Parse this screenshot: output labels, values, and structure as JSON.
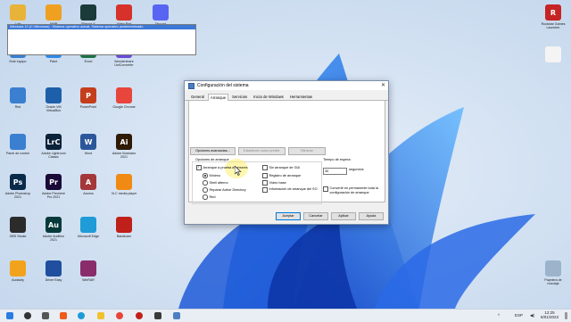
{
  "desktop": {
    "icons_col1": [
      {
        "label": "Lola",
        "icon": "folder-icon",
        "color": "#e8b339"
      },
      {
        "label": "Este equipo",
        "icon": "computer-icon",
        "color": "#3a7fd0"
      },
      {
        "label": "Red",
        "icon": "network-icon",
        "color": "#3a7fd0"
      },
      {
        "label": "Panel de control",
        "icon": "control-panel-icon",
        "color": "#3a7fd0"
      },
      {
        "label": "Adobe Photoshop 2021",
        "icon": "photoshop-icon",
        "color": "#0a2a4a",
        "glyph": "Ps"
      },
      {
        "label": "OBS Studio",
        "icon": "obs-icon",
        "color": "#2b2b2b"
      },
      {
        "label": "Audacity",
        "icon": "audacity-icon",
        "color": "#f2a31b"
      }
    ],
    "icons_col2": [
      {
        "label": "AIMP",
        "icon": "aimp-icon",
        "color": "#f0a020"
      },
      {
        "label": "Paint",
        "icon": "paint-icon",
        "color": "#2e8ae6"
      },
      {
        "label": "Oracle VM VirtualBox",
        "icon": "virtualbox-icon",
        "color": "#1d5fa8"
      },
      {
        "label": "Adobe Lightroom Classic",
        "icon": "lightroom-icon",
        "color": "#0b2239",
        "glyph": "LrC"
      },
      {
        "label": "Adobe Premiere Pro 2021",
        "icon": "premiere-icon",
        "color": "#1a0a38",
        "glyph": "Pr"
      },
      {
        "label": "Adobe Audition 2021",
        "icon": "audition-icon",
        "color": "#063a3a",
        "glyph": "Au"
      },
      {
        "label": "Driver Easy",
        "icon": "drivereasy-icon",
        "color": "#1f4f9e"
      }
    ],
    "icons_col3": [
      {
        "label": "Filmora X",
        "icon": "filmora-icon",
        "color": "#1b3a3a"
      },
      {
        "label": "Excel",
        "icon": "excel-icon",
        "color": "#1e7145",
        "glyph": "X"
      },
      {
        "label": "PowerPoint",
        "icon": "powerpoint-icon",
        "color": "#c43e1c",
        "glyph": "P"
      },
      {
        "label": "Word",
        "icon": "word-icon",
        "color": "#2b579a",
        "glyph": "W"
      },
      {
        "label": "Access",
        "icon": "access-icon",
        "color": "#a4373a",
        "glyph": "A"
      },
      {
        "label": "Microsoft Edge",
        "icon": "edge-icon",
        "color": "#1f9bd7"
      },
      {
        "label": "WinRAR",
        "icon": "winrar-icon",
        "color": "#8a2b6a"
      }
    ],
    "icons_col4": [
      {
        "label": "Video Pad",
        "icon": "videopad-icon",
        "color": "#d6312b"
      },
      {
        "label": "Wondershare UniConverter",
        "icon": "uniconverter-icon",
        "color": "#6a4bd6"
      },
      {
        "label": "Google Chrome",
        "icon": "chrome-icon",
        "color": "#e8453c"
      },
      {
        "label": "Adobe Illustrator 2021",
        "icon": "illustrator-icon",
        "color": "#2e1a05",
        "glyph": "Ai"
      },
      {
        "label": "VLC media player",
        "icon": "vlc-icon",
        "color": "#f08a14"
      },
      {
        "label": "Bandicam",
        "icon": "bandicam-icon",
        "color": "#c0201a"
      }
    ],
    "icons_col5": [
      {
        "label": "Discord",
        "icon": "discord-icon",
        "color": "#5865f2"
      }
    ],
    "icons_right": [
      {
        "label": "Rockstar Games Launcher",
        "icon": "rockstar-icon",
        "color": "#c62424",
        "glyph": "R"
      },
      {
        "label": "",
        "icon": "file-icon",
        "color": "#f4f4f4"
      },
      {
        "label": "Papelera de reciclaje",
        "icon": "recycle-bin-icon",
        "color": "#9bb4cc"
      }
    ]
  },
  "dialog": {
    "title": "Configuración del sistema",
    "tabs": [
      "General",
      "Arranque",
      "Servicios",
      "Inicio de Windows",
      "Herramientas"
    ],
    "active_tab": "Arranque",
    "os_entry": "Windows 10 (C:\\Windows) : Sistema operativo actual; Sistema operativo predeterminado",
    "buttons_row": {
      "advanced": "Opciones avanzadas...",
      "set_default": "Establecer como predet.",
      "delete": "Eliminar"
    },
    "boot_options_label": "Opciones de arranque",
    "safe_boot": "Arranque a prueba de errores",
    "safe_boot_checked": true,
    "radios": [
      "Mínimo",
      "Shell alterno",
      "Reparar Active Directory",
      "Red"
    ],
    "radio_selected": "Mínimo",
    "right_checks": [
      "Sin arranque de GUI",
      "Registro de arranque",
      "Vídeo base",
      "Información de arranque del SO"
    ],
    "timeout_label": "Tiempo de espera:",
    "timeout_value": "30",
    "timeout_unit": "segundos",
    "permanent": "Convertir en permanente toda la configuración de arranque",
    "footer": {
      "ok": "Aceptar",
      "cancel": "Cancelar",
      "apply": "Aplicar",
      "help": "Ayuda"
    }
  },
  "taskbar": {
    "language": "ESP",
    "time": "12:25",
    "date": "6/01/2023"
  },
  "colors": {
    "accent": "#0078d7",
    "selection": "#3b78d8"
  }
}
